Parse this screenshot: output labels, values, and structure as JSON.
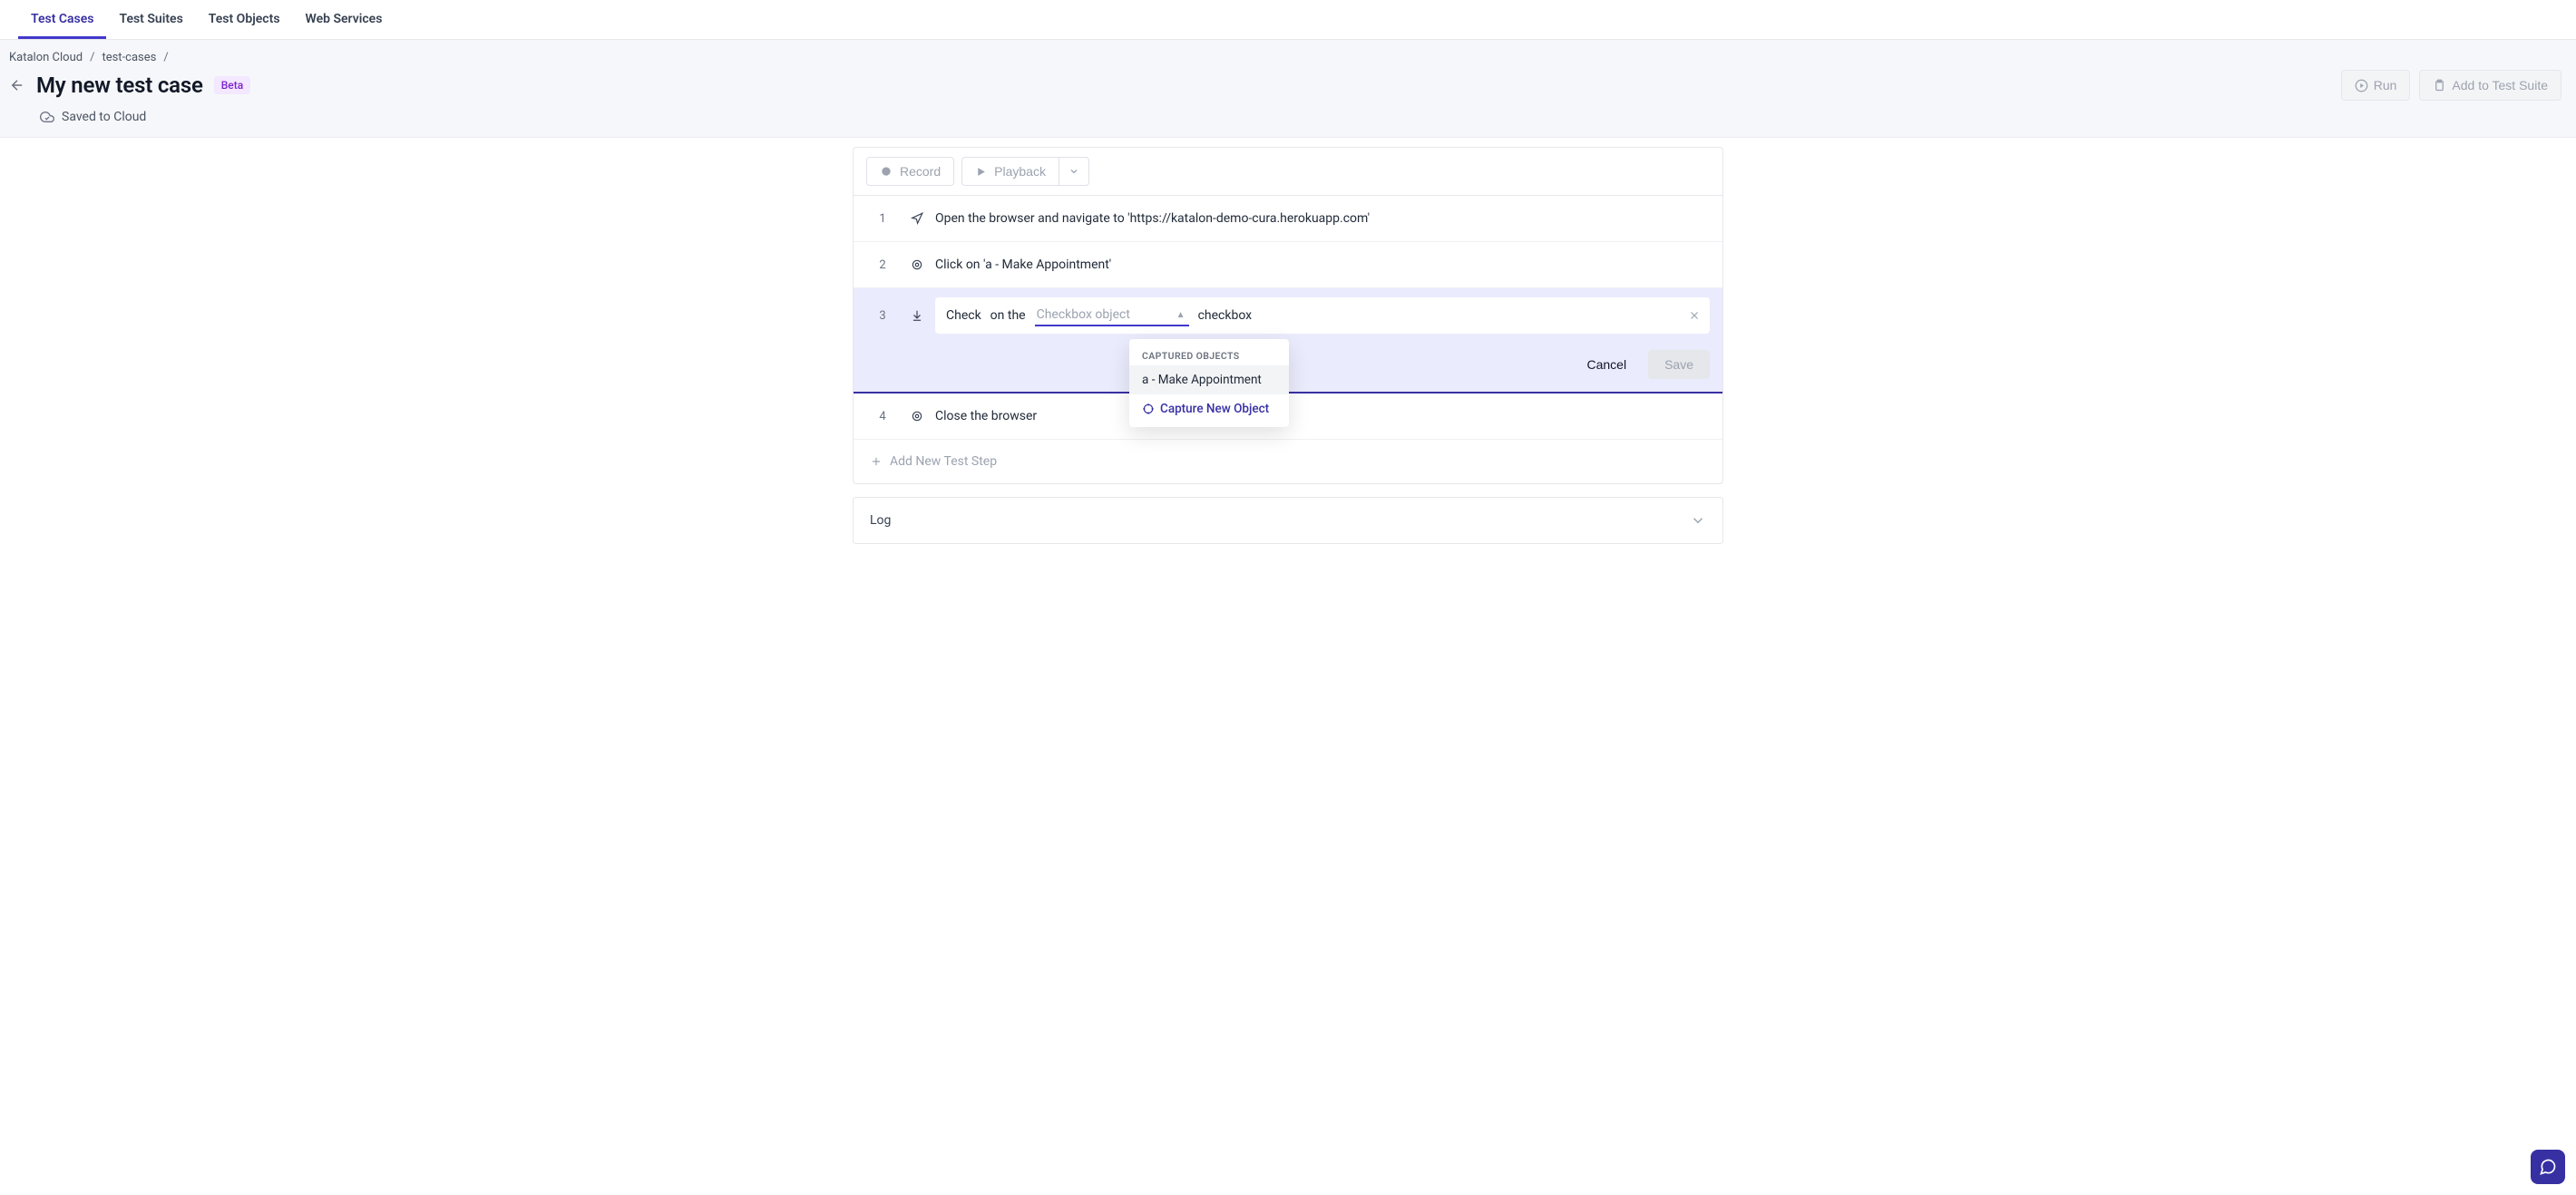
{
  "tabs": [
    "Test Cases",
    "Test Suites",
    "Test Objects",
    "Web Services"
  ],
  "active_tab_index": 0,
  "breadcrumbs": [
    "Katalon Cloud",
    "test-cases"
  ],
  "title": "My new test case",
  "badge": "Beta",
  "saved_text": "Saved to Cloud",
  "header_actions": {
    "run": "Run",
    "add_suite": "Add to Test Suite"
  },
  "toolbar": {
    "record": "Record",
    "playback": "Playback"
  },
  "steps": [
    {
      "num": "1",
      "icon": "navigate",
      "text": "Open the browser and navigate to 'https://katalon-demo-cura.herokuapp.com'"
    },
    {
      "num": "2",
      "icon": "cursor",
      "text": "Click on 'a - Make Appointment'"
    },
    {
      "num": "3",
      "icon": "check-down",
      "editing": true,
      "prefix": "Check",
      "middle": "on the",
      "placeholder": "Checkbox object",
      "suffix": "checkbox"
    },
    {
      "num": "4",
      "icon": "cursor",
      "text": "Close the browser"
    }
  ],
  "dropdown": {
    "header": "CAPTURED OBJECTS",
    "items": [
      "a - Make Appointment"
    ],
    "action": "Capture New Object"
  },
  "edit_actions": {
    "cancel": "Cancel",
    "save": "Save"
  },
  "add_step": "Add New Test Step",
  "log_label": "Log"
}
